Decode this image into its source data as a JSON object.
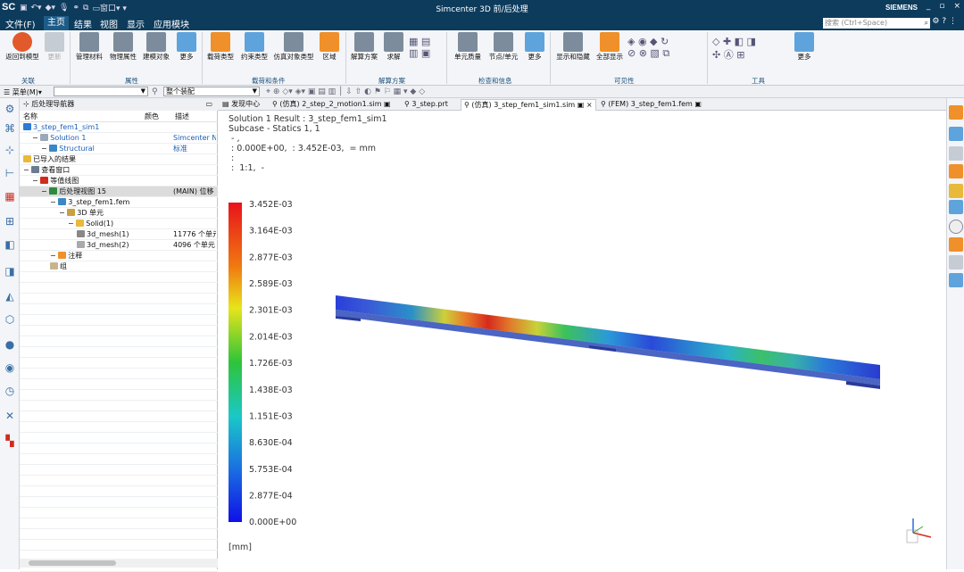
{
  "app": {
    "logo": "SC",
    "window_menu": "窗口",
    "title": "Simcenter 3D 前/后处理",
    "brand": "SIEMENS",
    "win_controls": [
      "_",
      "▫",
      "×"
    ]
  },
  "menu": {
    "items": [
      "文件(F)",
      "主页",
      "结果",
      "视图",
      "显示",
      "应用模块"
    ],
    "active": "主页",
    "search_placeholder": "搜索 (Ctrl+Space)"
  },
  "ribbon": {
    "buttons": [
      {
        "label": "返回到模型",
        "color": "#e25a2b"
      },
      {
        "label": "更新",
        "color": "#aab2bd"
      },
      {
        "label": "管理材料",
        "color": "#6b7c8f"
      },
      {
        "label": "物理属性",
        "color": "#6b7c8f"
      },
      {
        "label": "建模对象",
        "color": "#6b7c8f"
      },
      {
        "label": "更多",
        "color": "#3a87c8"
      },
      {
        "label": "载荷类型",
        "color": "#f0902a"
      },
      {
        "label": "约束类型",
        "color": "#3a87c8"
      },
      {
        "label": "仿真对象类型",
        "color": "#6b7c8f"
      },
      {
        "label": "区域",
        "color": "#f0902a"
      },
      {
        "label": "解算方案",
        "color": "#6b7c8f"
      },
      {
        "label": "求解",
        "color": "#6b7c8f"
      },
      {
        "label": "单元质量",
        "color": "#6b7c8f"
      },
      {
        "label": "节点/单元",
        "color": "#6b7c8f"
      },
      {
        "label": "更多",
        "color": "#3a87c8"
      },
      {
        "label": "显示和隐藏",
        "color": "#6b7c8f"
      },
      {
        "label": "全部显示",
        "color": "#f0902a"
      },
      {
        "label": "更多",
        "color": "#3a87c8"
      }
    ],
    "groups": [
      "关联",
      "属性",
      "载荷和条件",
      "解算方案",
      "检查和信息",
      "可见性",
      "工具"
    ]
  },
  "toolbar2": {
    "menu_label": "菜单(M)",
    "filter_value": "",
    "assembly_value": "整个装配"
  },
  "navigator": {
    "title": "后处理导航器",
    "columns": [
      "名称",
      "颜色",
      "描述"
    ],
    "rows": [
      {
        "name": "3_step_fem1_sim1",
        "desc": "",
        "indent": 0,
        "color": "#1a5fb4",
        "icon": "#2b7bd6"
      },
      {
        "name": "Solution 1",
        "desc": "Simcenter N",
        "indent": 1,
        "color": "#1a5fb4",
        "icon": "#9aa8b8"
      },
      {
        "name": "Structural",
        "desc": "标准",
        "indent": 2,
        "color": "#1a5fb4",
        "icon": "#3a87c8"
      },
      {
        "name": "已导入的结果",
        "desc": "",
        "indent": 0,
        "color": "#111",
        "icon": "#e8b93a"
      },
      {
        "name": "查看窗口",
        "desc": "",
        "indent": 0,
        "color": "#111",
        "icon": "#6b7c8f"
      },
      {
        "name": "等值线图",
        "desc": "",
        "indent": 1,
        "color": "#111",
        "icon": "#d12b1f"
      },
      {
        "name": "后处理视图 15",
        "desc": "(MAIN) 位移",
        "indent": 2,
        "color": "#111",
        "icon": "#2d8a3e",
        "sel": true
      },
      {
        "name": "3_step_fem1.fem",
        "desc": "",
        "indent": 3,
        "color": "#111",
        "icon": "#3a87c8"
      },
      {
        "name": "3D 单元",
        "desc": "",
        "indent": 4,
        "color": "#111",
        "icon": "#c8a040"
      },
      {
        "name": "Solid(1)",
        "desc": "",
        "indent": 5,
        "color": "#111",
        "icon": "#e8b93a"
      },
      {
        "name": "3d_mesh(1)",
        "desc": "11776 个单元",
        "indent": 6,
        "color": "#111",
        "icon": "#888"
      },
      {
        "name": "3d_mesh(2)",
        "desc": "4096 个单元",
        "indent": 6,
        "color": "#111",
        "icon": "#aaa"
      },
      {
        "name": "注释",
        "desc": "",
        "indent": 3,
        "color": "#111",
        "icon": "#f0902a"
      },
      {
        "name": "组",
        "desc": "",
        "indent": 3,
        "color": "#111",
        "icon": "#c8b48c"
      }
    ]
  },
  "tabs": [
    "发现中心",
    "(仿真) 2_step_2_motion1.sim",
    "3_step.prt",
    "(仿真) 3_step_fem1_sim1.sim",
    "(FEM) 3_step_fem1.fem"
  ],
  "active_tab": "(仿真) 3_step_fem1_sim1.sim",
  "viewport": {
    "info_lines": [
      "Solution 1 Result : 3_step_fem1_sim1",
      "Subcase - Statics 1,  1",
      " - ,",
      " : 0.000E+00,  : 3.452E-03,  = mm",
      " :",
      " :  1:1,  -"
    ],
    "legend_labels": [
      "3.452E-03",
      "3.164E-03",
      "2.877E-03",
      "2.589E-03",
      "2.301E-03",
      "2.014E-03",
      "1.726E-03",
      "1.438E-03",
      "1.151E-03",
      "8.630E-04",
      "5.753E-04",
      "2.877E-04",
      "0.000E+00"
    ],
    "unit": "[mm]"
  }
}
